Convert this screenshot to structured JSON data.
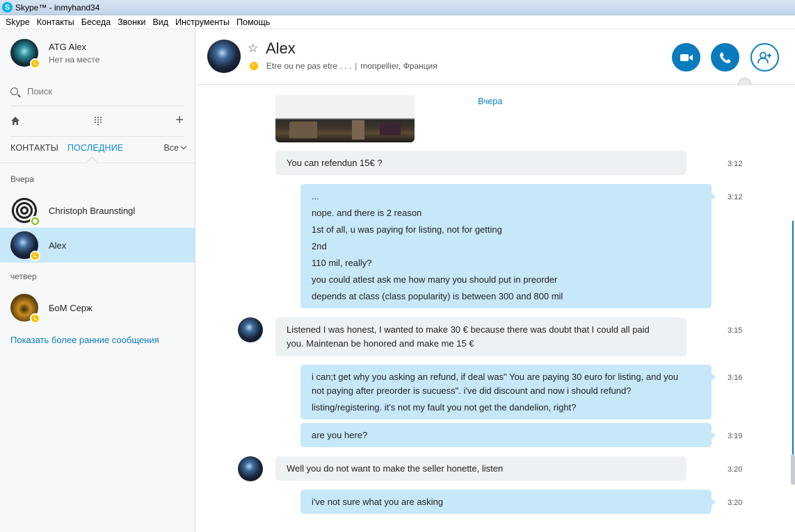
{
  "window": {
    "title": "Skype™ - inmyhand34"
  },
  "menu": [
    "Skype",
    "Контакты",
    "Беседа",
    "Звонки",
    "Вид",
    "Инструменты",
    "Помощь"
  ],
  "me": {
    "name": "ATG Alex",
    "mood": "Нет на месте"
  },
  "search": {
    "placeholder": "Поиск"
  },
  "tabs": {
    "contacts": "КОНТАКТЫ",
    "recent": "ПОСЛЕДНИЕ",
    "filter": "Все"
  },
  "groups": {
    "yesterday": "Вчера",
    "thursday": "четвер"
  },
  "contacts": [
    {
      "name": "Christoph Braunstingl",
      "status": "online"
    },
    {
      "name": "Alex",
      "status": "away"
    },
    {
      "name": "БоМ Серж",
      "status": "away"
    }
  ],
  "earlier_link": "Показать более ранние сообщения",
  "chat": {
    "name": "Alex",
    "mood": "Etre ou ne pas etre . . .",
    "location": "monpellier, Франция",
    "date_label": "Вчера"
  },
  "messages": [
    {
      "dir": "in",
      "lines": [
        "You can refendun 15€ ?"
      ],
      "time": "3:12"
    },
    {
      "dir": "out",
      "lines": [
        "...",
        "nope. and there is 2 reason",
        "1st of all, u was paying for listing, not for getting",
        "2nd",
        "110 mil, really?",
        "you could atlest ask me how many you should put in preorder",
        "depends at class (class popularity) is between 300 and 800 mil"
      ],
      "time": "3:12"
    },
    {
      "dir": "in",
      "lines": [
        "Listened I was honest, I wanted to make 30 € because there was doubt that I could all paid",
        "you. Maintenan be honored and make me 15 €"
      ],
      "time": "3:15"
    },
    {
      "dir": "out",
      "lines": [
        "i can;t get why you asking an refund, if deal was\" You are paying 30 euro for listing, and you",
        "not paying after preorder is sucuess\". i've did discount and now i should refund?",
        "listing/registering. it's not my fault you not get the dandelion, right?"
      ],
      "time": "3:16"
    },
    {
      "dir": "out",
      "lines": [
        "are you here?"
      ],
      "time": "3:19"
    },
    {
      "dir": "in",
      "lines": [
        "Well you do not want to make the seller honette, listen"
      ],
      "time": "3:20"
    },
    {
      "dir": "out",
      "lines": [
        "i've not sure what you are asking"
      ],
      "time": "3:20"
    }
  ],
  "colors": {
    "accent": "#0a7cbd",
    "outgoing_bubble": "#c7e8f9",
    "incoming_bubble": "#eef1f4",
    "away": "#ffc000",
    "online": "#7fba00"
  }
}
